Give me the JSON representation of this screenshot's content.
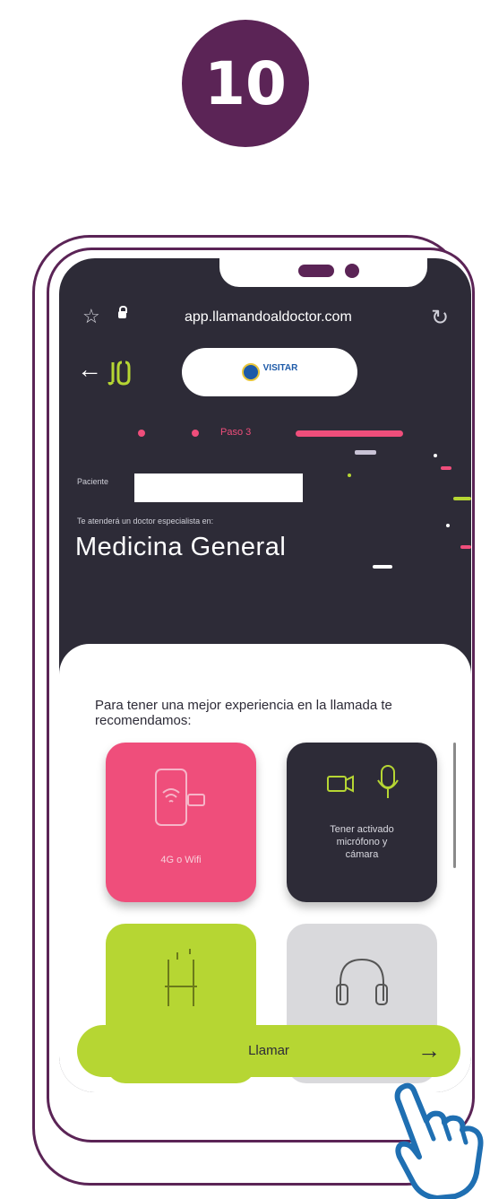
{
  "step_number": "10",
  "browser": {
    "url": "app.llamandoaldoctor.com"
  },
  "nav": {
    "back_arrow": "←",
    "logo_mark": "Ꞁ[Ꞁ",
    "brand": "VISITAR"
  },
  "progress": {
    "step_label": "Paso 3"
  },
  "patient": {
    "label": "Paciente",
    "value": ""
  },
  "specialty": {
    "intro": "Te atenderá un doctor especialista en:",
    "name": "Medicina General"
  },
  "recommendations": {
    "intro": "Para tener una mejor experiencia en la llamada te recomendamos:",
    "tiles": [
      {
        "label": "4G o Wifi",
        "icon": "phone-wifi-icon",
        "color": "#ef4e7b"
      },
      {
        "label": "Tener activado micrófono y cámara",
        "icon": "camera-mic-icon",
        "color": "#2d2b37"
      },
      {
        "label": "",
        "icon": "chair-icon",
        "color": "#b6d633"
      },
      {
        "label": "",
        "icon": "headphones-icon",
        "color": "#d9d9dc"
      }
    ]
  },
  "call_button": {
    "label": "Llamar",
    "arrow": "→"
  },
  "colors": {
    "brand_purple": "#5b2456",
    "dark_bg": "#2d2b37",
    "pink": "#ef4e7b",
    "lime": "#b6d633"
  }
}
